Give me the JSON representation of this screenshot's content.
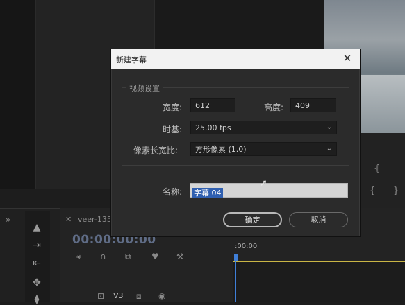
{
  "dialog": {
    "title": "新建字幕",
    "group_title": "视频设置",
    "width_label": "宽度:",
    "width_value": "612",
    "height_label": "高度:",
    "height_value": "409",
    "timebase_label": "时基:",
    "timebase_value": "25.00 fps",
    "pixel_aspect_label": "像素长宽比:",
    "pixel_aspect_value": "方形像素 (1.0)",
    "name_label": "名称:",
    "name_value": "字幕 04",
    "ok_label": "确定",
    "cancel_label": "取消"
  },
  "timeline": {
    "sequence_tab": "veer-135",
    "timecode": "00:00:00:00",
    "ruler_time": ":00:00",
    "track_label": "V3"
  },
  "colors": {
    "accent": "#3f7fd8",
    "selection": "#2f5fb0",
    "timecode": "#5f6c86",
    "work_area": "#c9b545"
  }
}
